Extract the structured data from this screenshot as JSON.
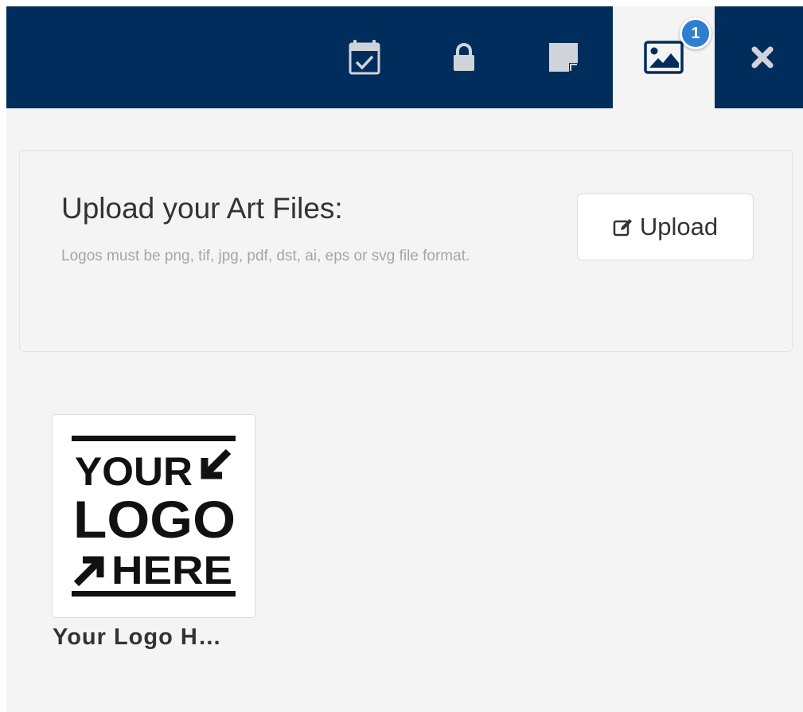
{
  "toolbar": {
    "tabs": [
      {
        "name": "calendar-check",
        "icon": "calendar-check-icon"
      },
      {
        "name": "lock",
        "icon": "lock-icon"
      },
      {
        "name": "sticky-note",
        "icon": "sticky-note-icon"
      },
      {
        "name": "art-files",
        "icon": "image-icon",
        "active": true,
        "badge": "1"
      },
      {
        "name": "close",
        "icon": "close-icon"
      }
    ],
    "badge_count": "1"
  },
  "upload": {
    "title": "Upload your Art Files:",
    "help_text": "Logos must be png, tif, jpg, pdf, dst, ai, eps or svg file format.",
    "button_label": "Upload"
  },
  "files": [
    {
      "caption": "Your Logo H…",
      "thumbnail_lines": [
        "YOUR",
        "LOGO",
        "HERE"
      ]
    }
  ],
  "colors": {
    "topbar": "#002d5c",
    "icon": "#d0d4da",
    "panel_bg": "#f4f4f4",
    "badge": "#2f7fd0"
  }
}
